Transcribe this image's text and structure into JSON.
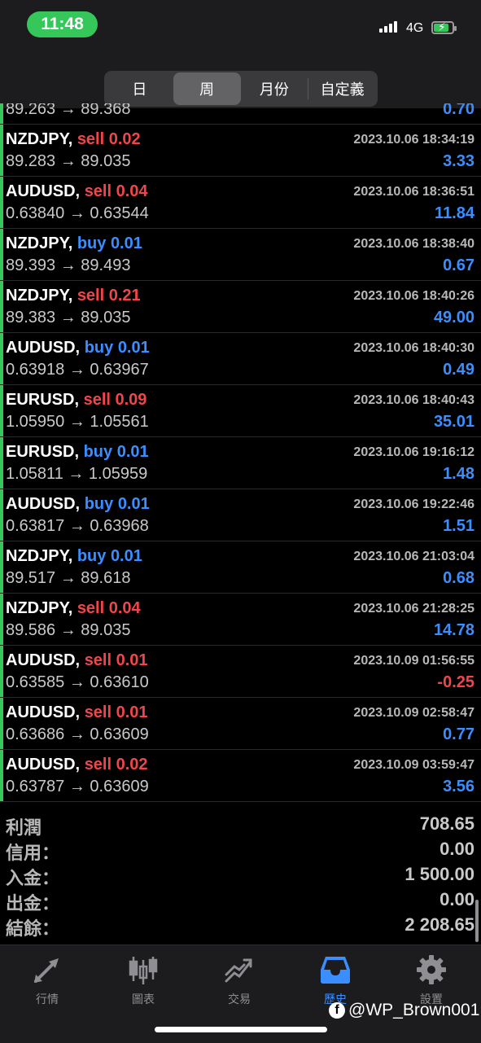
{
  "status_bar": {
    "time": "11:48",
    "network": "4G"
  },
  "segments": [
    {
      "label": "日",
      "active": false
    },
    {
      "label": "周",
      "active": true
    },
    {
      "label": "月份",
      "active": false
    },
    {
      "label": "自定義",
      "active": false
    }
  ],
  "partial_row": {
    "prices": "89.263 → 89.368",
    "profit": "0.70"
  },
  "deals": [
    {
      "symbol": "NZDJPY,",
      "side": "sell",
      "volume": "0.02",
      "datetime": "2023.10.06 18:34:19",
      "prices": "89.283 → 89.035",
      "profit": "3.33"
    },
    {
      "symbol": "AUDUSD,",
      "side": "sell",
      "volume": "0.04",
      "datetime": "2023.10.06 18:36:51",
      "prices": "0.63840 → 0.63544",
      "profit": "11.84"
    },
    {
      "symbol": "NZDJPY,",
      "side": "buy",
      "volume": "0.01",
      "datetime": "2023.10.06 18:38:40",
      "prices": "89.393 → 89.493",
      "profit": "0.67"
    },
    {
      "symbol": "NZDJPY,",
      "side": "sell",
      "volume": "0.21",
      "datetime": "2023.10.06 18:40:26",
      "prices": "89.383 → 89.035",
      "profit": "49.00"
    },
    {
      "symbol": "AUDUSD,",
      "side": "buy",
      "volume": "0.01",
      "datetime": "2023.10.06 18:40:30",
      "prices": "0.63918 → 0.63967",
      "profit": "0.49"
    },
    {
      "symbol": "EURUSD,",
      "side": "sell",
      "volume": "0.09",
      "datetime": "2023.10.06 18:40:43",
      "prices": "1.05950 → 1.05561",
      "profit": "35.01"
    },
    {
      "symbol": "EURUSD,",
      "side": "buy",
      "volume": "0.01",
      "datetime": "2023.10.06 19:16:12",
      "prices": "1.05811 → 1.05959",
      "profit": "1.48"
    },
    {
      "symbol": "AUDUSD,",
      "side": "buy",
      "volume": "0.01",
      "datetime": "2023.10.06 19:22:46",
      "prices": "0.63817 → 0.63968",
      "profit": "1.51"
    },
    {
      "symbol": "NZDJPY,",
      "side": "buy",
      "volume": "0.01",
      "datetime": "2023.10.06 21:03:04",
      "prices": "89.517 → 89.618",
      "profit": "0.68"
    },
    {
      "symbol": "NZDJPY,",
      "side": "sell",
      "volume": "0.04",
      "datetime": "2023.10.06 21:28:25",
      "prices": "89.586 → 89.035",
      "profit": "14.78"
    },
    {
      "symbol": "AUDUSD,",
      "side": "sell",
      "volume": "0.01",
      "datetime": "2023.10.09 01:56:55",
      "prices": "0.63585 → 0.63610",
      "profit": "-0.25"
    },
    {
      "symbol": "AUDUSD,",
      "side": "sell",
      "volume": "0.01",
      "datetime": "2023.10.09 02:58:47",
      "prices": "0.63686 → 0.63609",
      "profit": "0.77"
    },
    {
      "symbol": "AUDUSD,",
      "side": "sell",
      "volume": "0.02",
      "datetime": "2023.10.09 03:59:47",
      "prices": "0.63787 → 0.63609",
      "profit": "3.56"
    }
  ],
  "summary": [
    {
      "label": "利潤",
      "value": "708.65"
    },
    {
      "label": "信用：",
      "value": "0.00"
    },
    {
      "label": "入金：",
      "value": "1 500.00"
    },
    {
      "label": "出金：",
      "value": "0.00"
    },
    {
      "label": "結餘：",
      "value": "2 208.65"
    }
  ],
  "tabs": [
    {
      "label": "行情",
      "icon": "quotes-arrows-icon",
      "active": false
    },
    {
      "label": "圖表",
      "icon": "candlestick-chart-icon",
      "active": false
    },
    {
      "label": "交易",
      "icon": "trade-chart-icon",
      "active": false
    },
    {
      "label": "歷史",
      "icon": "history-inbox-icon",
      "active": true
    },
    {
      "label": "設置",
      "icon": "gear-icon",
      "active": false
    }
  ],
  "watermark": "@WP_Brown001",
  "colors": {
    "sell": "#f0464a",
    "buy": "#3a8eff",
    "positive_profit": "#3a8eff",
    "negative_profit": "#f0464a",
    "accent_bar": "#35c759"
  }
}
